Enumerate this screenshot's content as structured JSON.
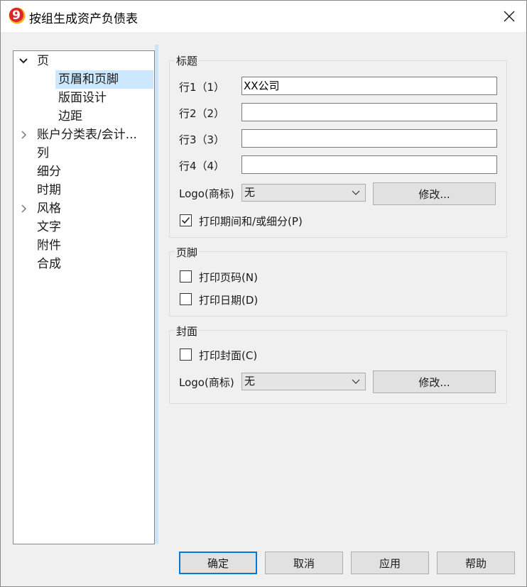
{
  "window": {
    "title": "按组生成资产负债表",
    "accent_color": "#0078d7"
  },
  "tree": {
    "items": [
      {
        "label": "页",
        "state": "expanded"
      },
      {
        "label": "页眉和页脚",
        "selected": true
      },
      {
        "label": "版面设计"
      },
      {
        "label": "边距"
      },
      {
        "label": "账户分类表/会计...",
        "state": "collapsed"
      },
      {
        "label": "列"
      },
      {
        "label": "细分"
      },
      {
        "label": "时期"
      },
      {
        "label": "风格",
        "state": "collapsed"
      },
      {
        "label": "文字"
      },
      {
        "label": "附件"
      },
      {
        "label": "合成"
      }
    ]
  },
  "header_group": {
    "title": "标题",
    "rows": [
      {
        "label": "行1（1）",
        "value": "XX公司"
      },
      {
        "label": "行2（2）",
        "value": ""
      },
      {
        "label": "行3（3）",
        "value": ""
      },
      {
        "label": "行4（4）",
        "value": ""
      }
    ],
    "logo_label": "Logo(商标)",
    "logo_value": "无",
    "modify_label": "修改...",
    "print_period_label": "打印期间和/或细分(P)",
    "print_period_checked": true
  },
  "footer_group": {
    "title": "页脚",
    "print_page_label": "打印页码(N)",
    "print_page_checked": false,
    "print_date_label": "打印日期(D)",
    "print_date_checked": false
  },
  "cover_group": {
    "title": "封面",
    "print_cover_label": "打印封面(C)",
    "print_cover_checked": false,
    "logo_label": "Logo(商标)",
    "logo_value": "无",
    "modify_label": "修改..."
  },
  "buttons": {
    "ok": "确定",
    "cancel": "取消",
    "apply": "应用",
    "help": "帮助"
  }
}
